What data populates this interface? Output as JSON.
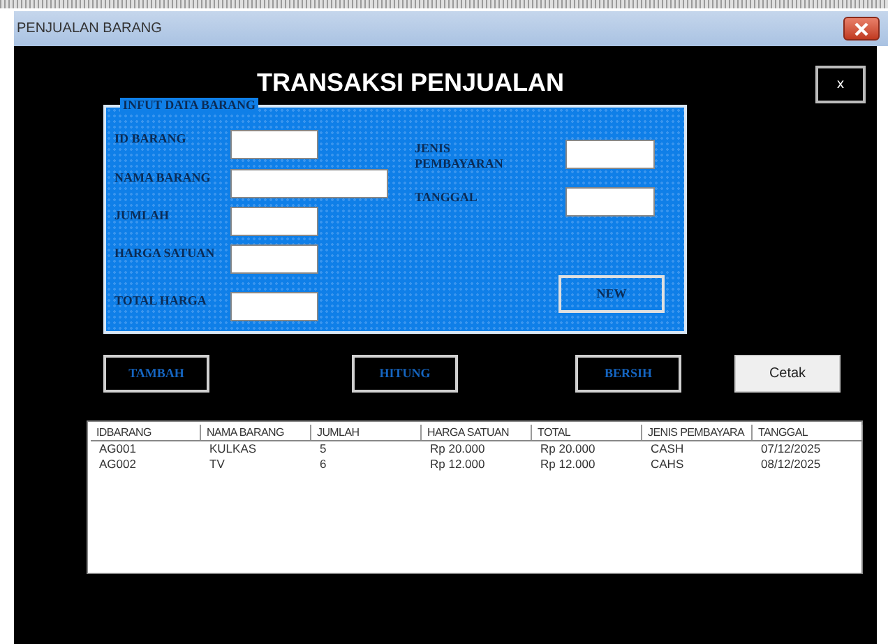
{
  "window": {
    "title": "PENJUALAN BARANG"
  },
  "heading": "TRANSAKSI PENJUALAN",
  "close_button": "x",
  "group": {
    "legend": "INFUT DATA BARANG",
    "fields": [
      {
        "label": "ID BARANG"
      },
      {
        "label": "NAMA BARANG"
      },
      {
        "label": "JUMLAH"
      },
      {
        "label": "HARGA SATUAN"
      },
      {
        "label": "TOTAL HARGA"
      },
      {
        "label": "JENIS PEMBAYARAN"
      },
      {
        "label": "TANGGAL"
      }
    ],
    "new_button": "NEW"
  },
  "buttons": [
    {
      "label": "TAMBAH",
      "kind": "dark"
    },
    {
      "label": "HITUNG",
      "kind": "dark"
    },
    {
      "label": "BERSIH",
      "kind": "dark"
    },
    {
      "label": "Cetak",
      "kind": "light"
    }
  ],
  "table": {
    "columns": [
      "IDBARANG",
      "NAMA BARANG",
      "JUMLAH",
      "HARGA SATUAN",
      "TOTAL",
      "JENIS PEMBAYARA",
      "TANGGAL"
    ],
    "rows": [
      [
        "AG001",
        "KULKAS",
        "5",
        "Rp 20.000",
        "Rp 20.000",
        "CASH",
        "07/12/2025"
      ],
      [
        "AG002",
        "TV",
        "6",
        "Rp 12.000",
        "Rp 12.000",
        "CAHS",
        "08/12/2025"
      ]
    ]
  }
}
